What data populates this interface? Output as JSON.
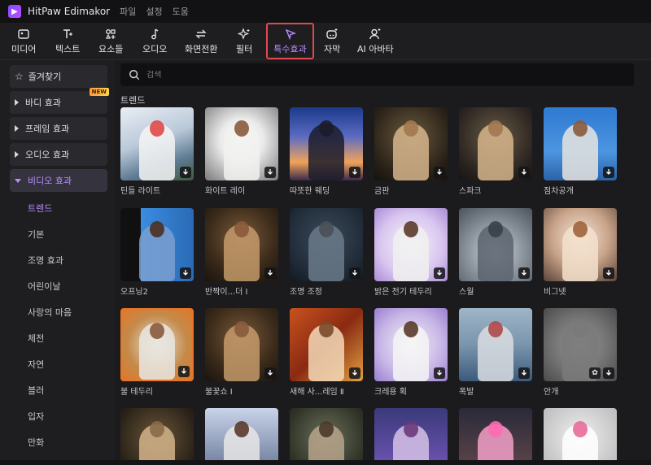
{
  "titlebar": {
    "app_name": "HitPaw Edimakor",
    "menu": [
      "파일",
      "설정",
      "도움"
    ]
  },
  "toolbar": {
    "items": [
      {
        "label": "미디어",
        "icon": "media-icon"
      },
      {
        "label": "텍스트",
        "icon": "text-icon"
      },
      {
        "label": "요소들",
        "icon": "elements-icon"
      },
      {
        "label": "오디오",
        "icon": "audio-icon"
      },
      {
        "label": "화면전환",
        "icon": "transition-icon"
      },
      {
        "label": "필터",
        "icon": "filter-icon"
      },
      {
        "label": "특수효과",
        "icon": "effects-icon",
        "active": true
      },
      {
        "label": "자막",
        "icon": "subtitle-icon"
      },
      {
        "label": "AI 아바타",
        "icon": "avatar-icon"
      }
    ]
  },
  "sidebar": {
    "favorites": "즐겨찾기",
    "categories": [
      {
        "label": "바디 효과",
        "badge": "NEW"
      },
      {
        "label": "프레임 효과"
      },
      {
        "label": "오디오 효과"
      },
      {
        "label": "비디오 효과",
        "expanded": true
      }
    ],
    "subitems": [
      "트렌드",
      "기본",
      "조명 효과",
      "어린이날",
      "사랑의 마음",
      "체전",
      "자연",
      "블러",
      "입자",
      "만화"
    ]
  },
  "search": {
    "placeholder": "검색"
  },
  "section": {
    "title": "트렌드"
  },
  "cards": [
    {
      "label": "틴들 라이트"
    },
    {
      "label": "화이트 레이"
    },
    {
      "label": "따뜻한 웨딩"
    },
    {
      "label": "금판"
    },
    {
      "label": "스파크"
    },
    {
      "label": "점차공개"
    },
    {
      "label": "오프닝2"
    },
    {
      "label": "반짝이...더 Ⅰ"
    },
    {
      "label": "조명 조정"
    },
    {
      "label": "밝은 전기 테두리"
    },
    {
      "label": "스월"
    },
    {
      "label": "비그넷"
    },
    {
      "label": "불 테두리"
    },
    {
      "label": "불꽃쇼 Ⅰ"
    },
    {
      "label": "새해 사...레임 Ⅱ"
    },
    {
      "label": "크레용 획"
    },
    {
      "label": "폭발"
    },
    {
      "label": "안개"
    },
    {
      "label": ""
    },
    {
      "label": ""
    },
    {
      "label": ""
    },
    {
      "label": ""
    },
    {
      "label": ""
    },
    {
      "label": ""
    }
  ],
  "colors": {
    "accent": "#b98cff",
    "active_outline": "#e0484e",
    "background": "#1b1b1e"
  }
}
